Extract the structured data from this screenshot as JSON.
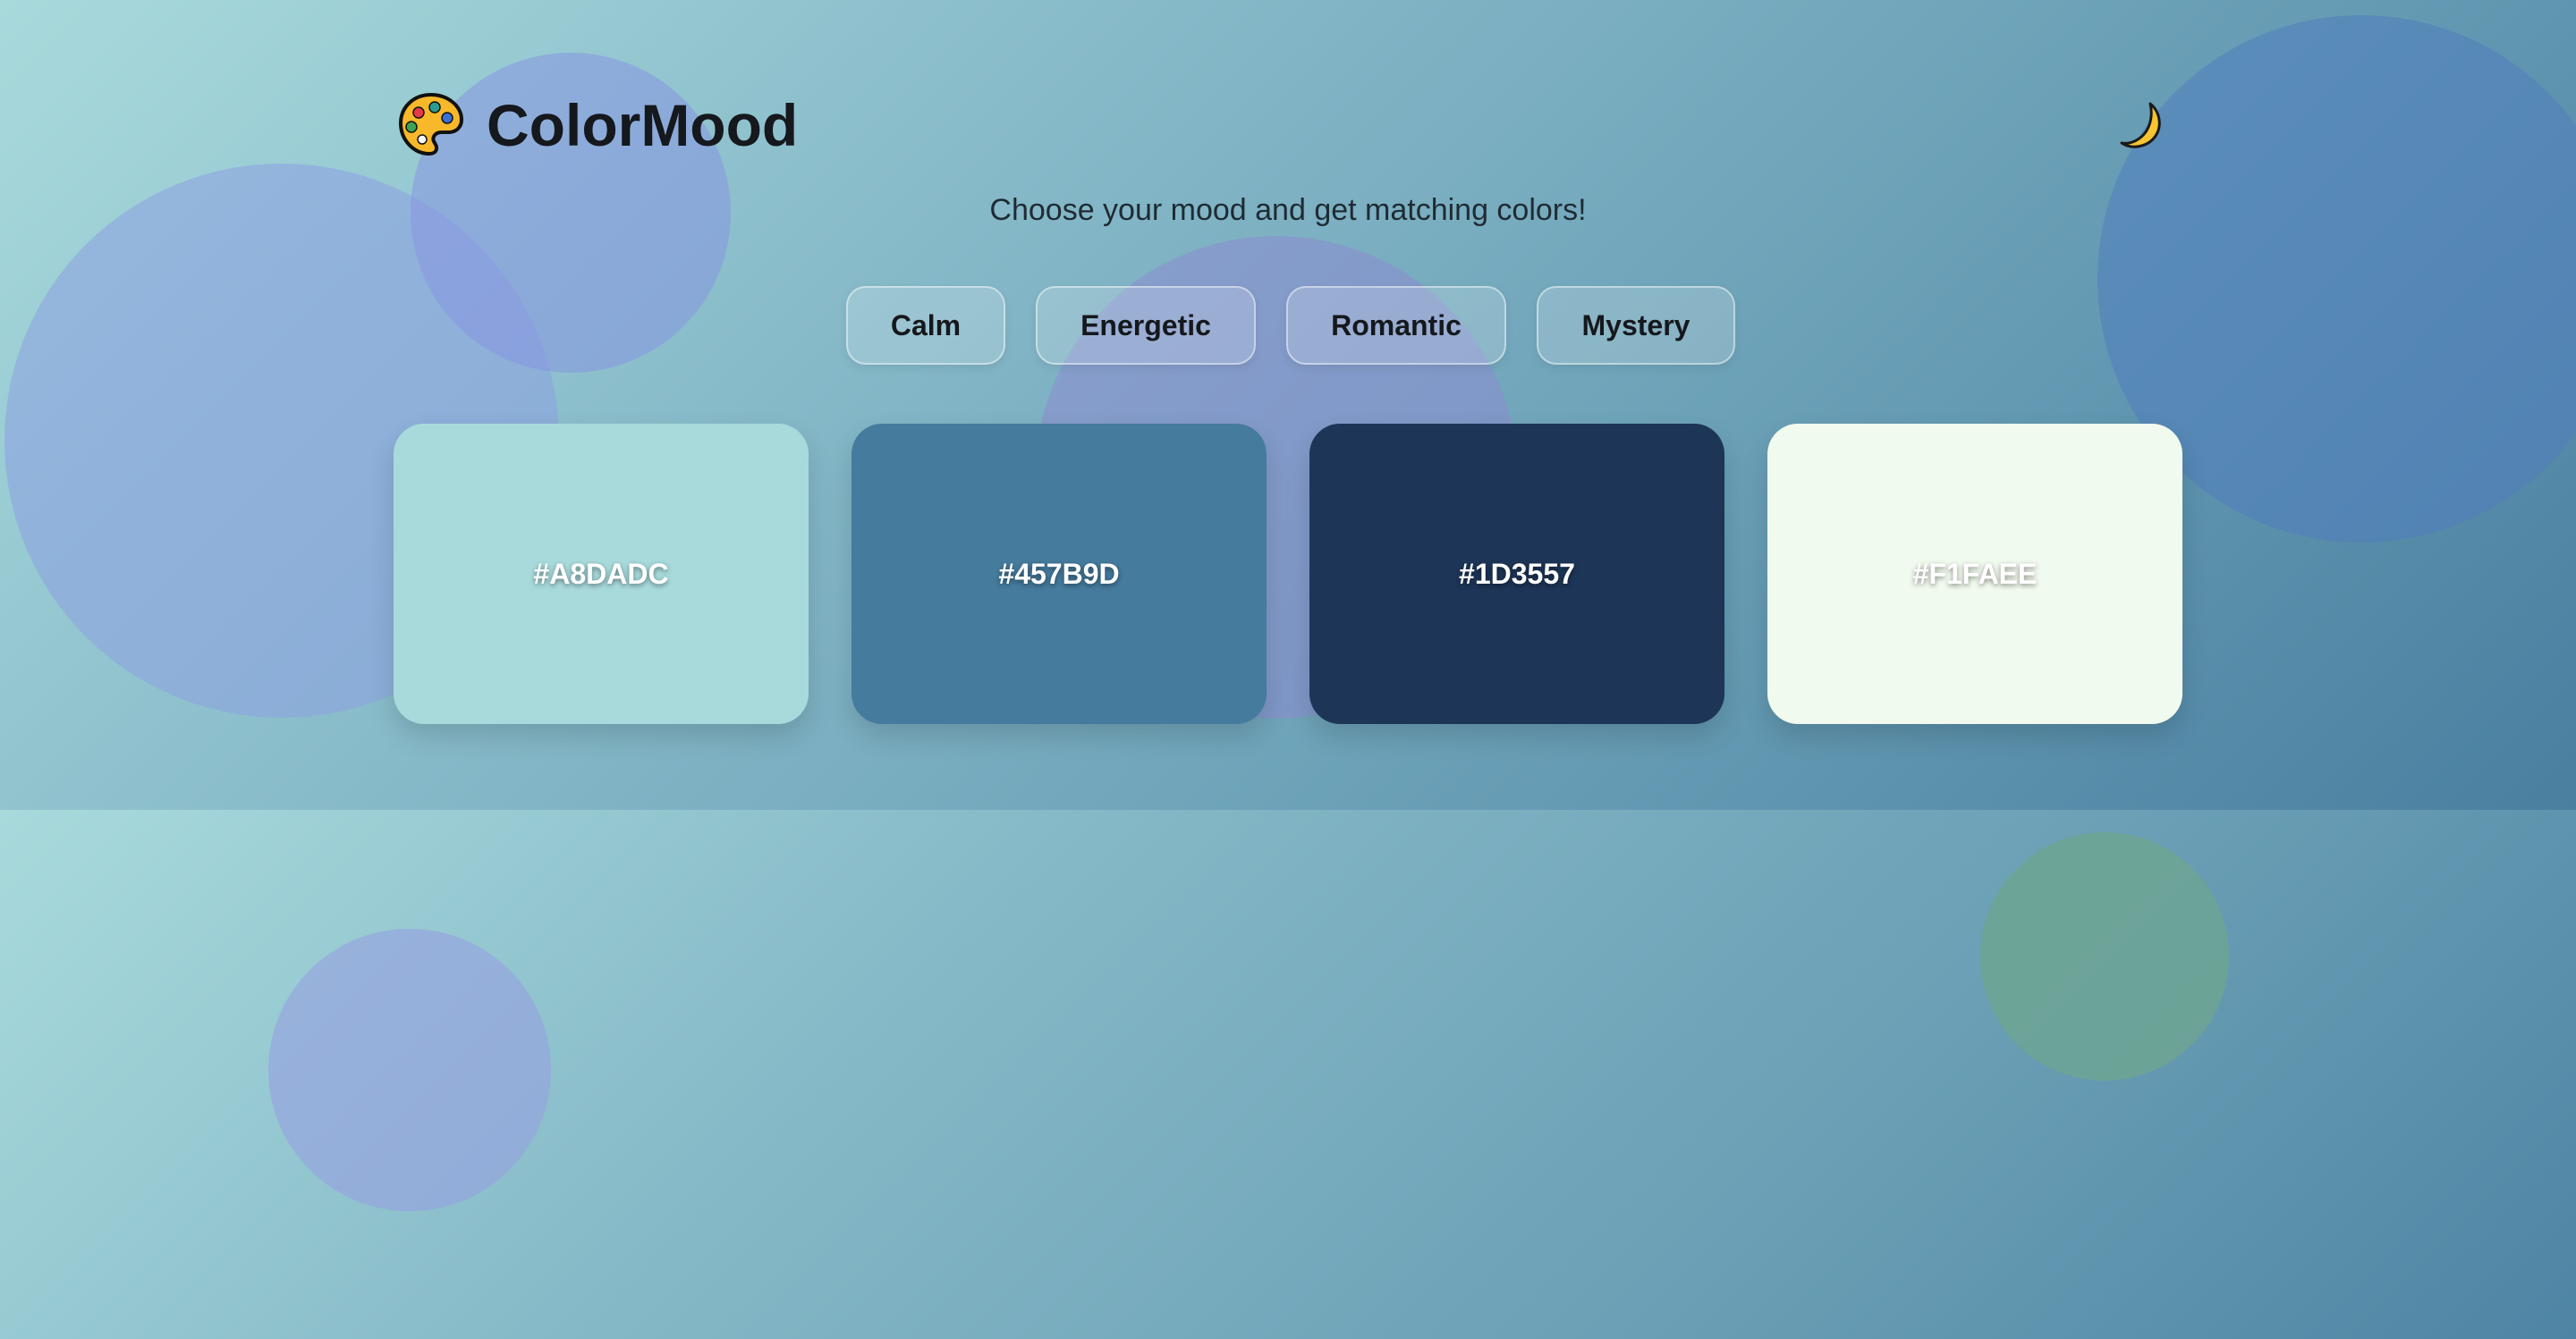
{
  "app": {
    "name": "ColorMood",
    "logo_icon": "palette-icon",
    "theme_toggle_icon": "crescent-moon-icon"
  },
  "subtitle": "Choose your mood and get matching colors!",
  "moods": [
    {
      "label": "Calm"
    },
    {
      "label": "Energetic"
    },
    {
      "label": "Romantic"
    },
    {
      "label": "Mystery"
    }
  ],
  "palette": [
    {
      "hex": "#A8DADC",
      "color": "#A8DADC"
    },
    {
      "hex": "#457B9D",
      "color": "#457B9D"
    },
    {
      "hex": "#1D3557",
      "color": "#1D3557"
    },
    {
      "hex": "#F1FAEE",
      "color": "#F1FAEE"
    }
  ]
}
